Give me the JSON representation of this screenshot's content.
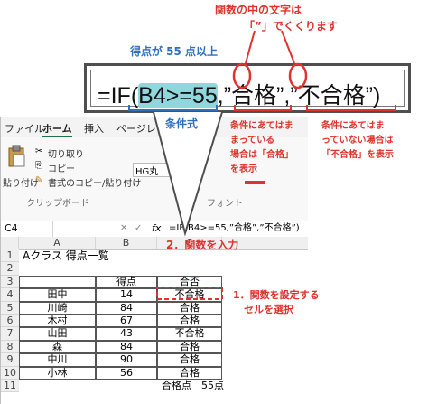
{
  "annotations": {
    "top_note_line1": "関数の中の文字は",
    "top_note_line2": "”」でくくります",
    "top_note_line2_prefix": "「",
    "condition_label": "得点が 55 点以上",
    "condition_caption": "条件式",
    "true_note": [
      "条件にあてはま",
      "まっている",
      "場合は「合格」",
      "を表示"
    ],
    "false_note": [
      "条件にあてはま",
      "っていない場合は",
      "「不合格」を表示"
    ],
    "step1_line1": "1．関数を設定する",
    "step1_line2": "セルを選択",
    "step2": "2．関数を入力"
  },
  "big_formula": {
    "prefix": "=IF(",
    "condition": "B4>=55",
    "sep1": ",",
    "true_text": "”合格”",
    "sep2": ",",
    "false_text": "”不合格”",
    "suffix": ")"
  },
  "ribbon": {
    "tabs": [
      "ファイル",
      "ホーム",
      "挿入",
      "ページレ"
    ],
    "paste": "貼り付け",
    "cut": "切り取り",
    "copy": "コピー",
    "format_painter": "書式のコピー/貼り付け",
    "clipboard_group": "クリップボード",
    "font_name": "HG丸",
    "font_group": "フォント"
  },
  "formula_bar": {
    "name_box": "C4",
    "fx": "fx",
    "formula": "=IF(B4>=55,”合格”,”不合格”)"
  },
  "sheet": {
    "columns": [
      "A",
      "B",
      "C"
    ],
    "rows": [
      "1",
      "2",
      "3",
      "4",
      "5",
      "6",
      "7",
      "8",
      "9",
      "10",
      "11"
    ],
    "title": "Aクラス 得点一覧",
    "header": [
      "",
      "得点",
      "合否"
    ],
    "data": [
      [
        "田中",
        "14",
        "不合格"
      ],
      [
        "川崎",
        "84",
        "合格"
      ],
      [
        "木村",
        "67",
        "合格"
      ],
      [
        "山田",
        "43",
        "不合格"
      ],
      [
        "森",
        "84",
        "合格"
      ],
      [
        "中川",
        "90",
        "合格"
      ],
      [
        "小林",
        "56",
        "合格"
      ]
    ],
    "footer_label": "合格点",
    "footer_value": "55点"
  },
  "colors": {
    "annotation_red": "#e0322e",
    "annotation_blue": "#2f6fbf",
    "highlight": "#8fd7dd"
  }
}
